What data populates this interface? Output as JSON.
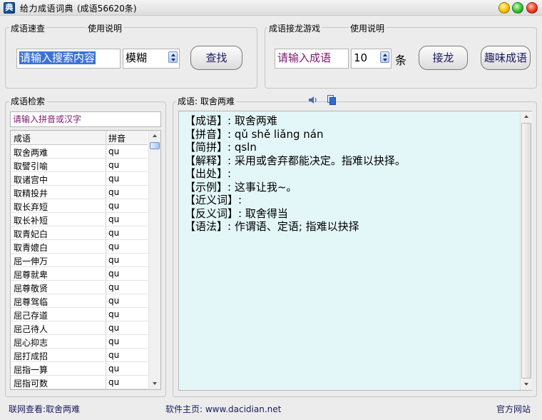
{
  "titlebar": {
    "title": "给力成语词典",
    "subtitle": "(成语56620条)"
  },
  "quick_search": {
    "label": "成语速查",
    "help_label": "使用说明",
    "input_value": "请输入搜索内容",
    "mode_value": "模糊",
    "search_button": "查找"
  },
  "relay_game": {
    "label": "成语接龙游戏",
    "help_label": "使用说明",
    "input_value": "请输入成语",
    "count_value": "10",
    "count_unit": "条",
    "relay_button": "接龙",
    "fun_button": "趣味成语"
  },
  "idiom_search": {
    "label": "成语检索",
    "filter_placeholder": "请输入拼音或汉字",
    "columns": [
      "成语",
      "拼音"
    ],
    "rows": [
      {
        "idiom": "取舍两难",
        "pinyin": "qu"
      },
      {
        "idiom": "取譬引喻",
        "pinyin": "qu"
      },
      {
        "idiom": "取诸宫中",
        "pinyin": "qu"
      },
      {
        "idiom": "取精投井",
        "pinyin": "qu"
      },
      {
        "idiom": "取长弃短",
        "pinyin": "qu"
      },
      {
        "idiom": "取长补短",
        "pinyin": "qu"
      },
      {
        "idiom": "取青妃白",
        "pinyin": "qu"
      },
      {
        "idiom": "取青媲白",
        "pinyin": "qu"
      },
      {
        "idiom": "屈一伸万",
        "pinyin": "qu"
      },
      {
        "idiom": "屈尊就卑",
        "pinyin": "qu"
      },
      {
        "idiom": "屈尊敬贤",
        "pinyin": "qu"
      },
      {
        "idiom": "屈尊驾临",
        "pinyin": "qu"
      },
      {
        "idiom": "屈己存道",
        "pinyin": "qu"
      },
      {
        "idiom": "屈己待人",
        "pinyin": "qu"
      },
      {
        "idiom": "屈心抑志",
        "pinyin": "qu"
      },
      {
        "idiom": "屈打成招",
        "pinyin": "qu"
      },
      {
        "idiom": "屈指一算",
        "pinyin": "qu"
      },
      {
        "idiom": "屈指可数",
        "pinyin": "qu"
      }
    ]
  },
  "detail": {
    "label": "成语: 取舍两难",
    "lines": [
      "【成语】: 取舍两难",
      "【拼音】: qǔ  shě  liǎng  nán",
      "【简拼】: qsln",
      "【解释】: 采用或舍弃都能决定。指难以抉择。",
      "【出处】:",
      "【示例】: 这事让我~。",
      "【近义词】:",
      "【反义词】: 取舍得当",
      "【语法】: 作谓语、定语; 指难以抉择"
    ]
  },
  "statusbar": {
    "online_lookup": "联网查看:取舍两难",
    "homepage": "软件主页: www.dacidian.net",
    "official_site": "官方网站"
  }
}
